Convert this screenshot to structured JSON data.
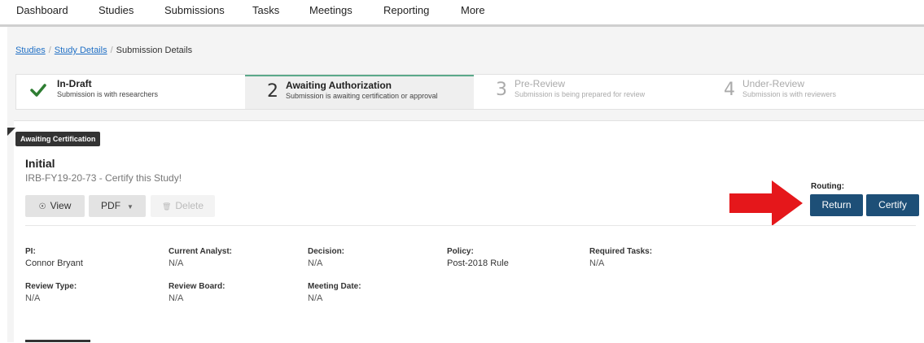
{
  "nav": {
    "items": [
      "Dashboard",
      "Studies",
      "Submissions",
      "Tasks",
      "Meetings",
      "Reporting",
      "More"
    ]
  },
  "breadcrumb": {
    "studies": "Studies",
    "study_details": "Study Details",
    "current": "Submission Details",
    "separator": "/"
  },
  "stepper": [
    {
      "number": "",
      "title": "In-Draft",
      "subtitle": "Submission is with researchers",
      "state": "complete"
    },
    {
      "number": "2",
      "title": "Awaiting Authorization",
      "subtitle": "Submission is awaiting certification or approval",
      "state": "active"
    },
    {
      "number": "3",
      "title": "Pre-Review",
      "subtitle": "Submission is being prepared for review",
      "state": "future"
    },
    {
      "number": "4",
      "title": "Under-Review",
      "subtitle": "Submission is with reviewers",
      "state": "future"
    }
  ],
  "submission": {
    "status_badge": "Awaiting Certification",
    "type": "Initial",
    "name": "IRB-FY19-20-73 - Certify this Study!"
  },
  "actions": {
    "view": "View",
    "pdf": "PDF",
    "delete": "Delete"
  },
  "routing": {
    "label": "Routing:",
    "return": "Return",
    "certify": "Certify"
  },
  "details": {
    "pi": {
      "label": "PI:",
      "value": "Connor Bryant"
    },
    "current_analyst": {
      "label": "Current Analyst:",
      "value": "N/A"
    },
    "decision": {
      "label": "Decision:",
      "value": "N/A"
    },
    "policy": {
      "label": "Policy:",
      "value": "Post-2018 Rule"
    },
    "required_tasks": {
      "label": "Required Tasks:",
      "value": "N/A"
    },
    "review_type": {
      "label": "Review Type:",
      "value": "N/A"
    },
    "review_board": {
      "label": "Review Board:",
      "value": "N/A"
    },
    "meeting_date": {
      "label": "Meeting Date:",
      "value": "N/A"
    }
  },
  "colors": {
    "primary_button": "#1d4f77",
    "check": "#2e7d32",
    "active_step_border": "#5aa98a",
    "annotation_arrow": "#e5171b"
  },
  "icons": {
    "check": "check-icon",
    "view": "eye-icon",
    "pdf_dropdown": "caret-down-icon",
    "delete": "trash-icon",
    "annotation": "red-arrow"
  }
}
